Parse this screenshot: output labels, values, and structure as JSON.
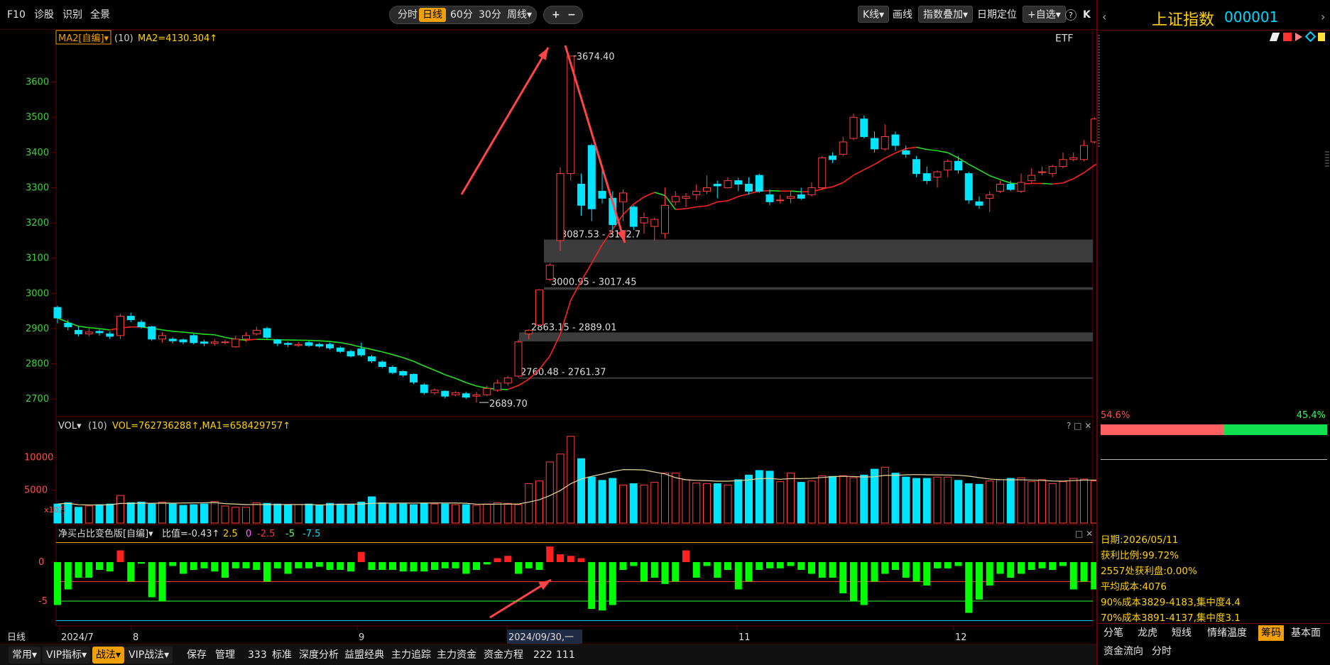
{
  "toolbar": {
    "f10": "F10",
    "diagnose": "诊股",
    "recognize": "识别",
    "panorama": "全景",
    "periods": [
      "分时",
      "日线",
      "60分",
      "30分",
      "周线▾"
    ],
    "active_period": "日线",
    "zoom_in": "+",
    "zoom_out": "−",
    "kline": "K线▾",
    "draw": "画线",
    "index_overlay": "指数叠加▾",
    "date_locate": "日期定位",
    "watchlist": "+自选▾",
    "help": "?",
    "collapse": "K"
  },
  "main_chart": {
    "indicator_label": "MA2[自编]▾",
    "indicator_params": "(10)",
    "indicator_value": "MA2=4130.304↑",
    "etf": "ETF",
    "y_ticks": [
      "3600",
      "3500",
      "3400",
      "3300",
      "3200",
      "3100",
      "3000",
      "2900",
      "2800",
      "2700"
    ],
    "annotations": {
      "peak": "3674.40",
      "low": "2689.70",
      "zone1": "3087.53 - 3152.7",
      "zone2": "3000.95 - 3017.45",
      "zone3": "2863.15 - 2889.01",
      "zone4": "2760.48 - 2761.37"
    }
  },
  "volume_panel": {
    "label": "VOL▾",
    "params": "(10)",
    "values": "VOL=762736288↑,MA1=658429757↑",
    "y_ticks": [
      "10000",
      "5000"
    ],
    "unit": "x10万"
  },
  "net_buy_panel": {
    "label": "净买占比变色版[自编]▾",
    "ratio": "比值=-0.43↑",
    "levels": [
      "2.5",
      "0",
      "-2.5",
      "-5",
      "-7.5"
    ],
    "level_colors": [
      "#ffd200",
      "#ff66ff",
      "#ff3333",
      "#66ff66",
      "#00e5ff"
    ],
    "y_ticks": [
      "0",
      "-5"
    ]
  },
  "x_axis": {
    "period_label": "日线",
    "labels": [
      "2024/7",
      "8",
      "9",
      "2024/09/30,一",
      "11",
      "12"
    ]
  },
  "bottom_bar": {
    "items": [
      "常用▾",
      "VIP指标▾",
      "战法▾",
      "VIP战法▾",
      "保存",
      "管理",
      "333",
      "标准",
      "深度分析",
      "益盟经典",
      "主力追踪",
      "主力资金",
      "资金方程",
      "222",
      "111"
    ],
    "selected": "战法▾"
  },
  "right_panel": {
    "title": "上证指数",
    "code": "000001",
    "left_pct": "54.6%",
    "right_pct": "45.4%",
    "info": [
      "日期:2026/05/11",
      "获利比例:99.72%",
      "2557处获利盘:0.00%",
      "平均成本:4076",
      "90%成本3829-4183,集中度4.4",
      "70%成本3891-4137,集中度3.1"
    ],
    "tabs_row1": [
      "分笔",
      "龙虎",
      "短线",
      "情绪温度",
      "筹码",
      "基本面"
    ],
    "tabs_row2": [
      "资金流向",
      "分时"
    ],
    "selected_tab": "筹码"
  },
  "colors": {
    "up": "#ff4040",
    "down": "#00e5ff",
    "ma_up": "#ff2020",
    "ma_down": "#20e020",
    "net_pos": "#ff2020",
    "net_neg": "#00ff00",
    "accent": "#f0a000",
    "gold": "#ffd200"
  },
  "chart_data": {
    "type": "candlestick",
    "title": "上证指数",
    "y_range": [
      2660,
      3700
    ],
    "candles": [
      [
        2960,
        2930,
        2965,
        2915
      ],
      [
        2915,
        2905,
        2925,
        2895
      ],
      [
        2895,
        2885,
        2905,
        2878
      ],
      [
        2885,
        2890,
        2900,
        2878
      ],
      [
        2892,
        2888,
        2898,
        2880
      ],
      [
        2885,
        2878,
        2892,
        2870
      ],
      [
        2880,
        2935,
        2942,
        2870
      ],
      [
        2935,
        2925,
        2945,
        2918
      ],
      [
        2918,
        2905,
        2925,
        2900
      ],
      [
        2905,
        2870,
        2908,
        2865
      ],
      [
        2870,
        2880,
        2890,
        2860
      ],
      [
        2870,
        2865,
        2875,
        2858
      ],
      [
        2868,
        2862,
        2872,
        2855
      ],
      [
        2880,
        2860,
        2885,
        2855
      ],
      [
        2862,
        2858,
        2868,
        2850
      ],
      [
        2858,
        2862,
        2870,
        2852
      ],
      [
        2860,
        2862,
        2868,
        2855
      ],
      [
        2848,
        2870,
        2880,
        2845
      ],
      [
        2870,
        2880,
        2890,
        2862
      ],
      [
        2885,
        2895,
        2905,
        2880
      ],
      [
        2900,
        2875,
        2905,
        2870
      ],
      [
        2868,
        2858,
        2870,
        2850
      ],
      [
        2858,
        2855,
        2862,
        2848
      ],
      [
        2852,
        2855,
        2862,
        2848
      ],
      [
        2860,
        2852,
        2865,
        2848
      ],
      [
        2855,
        2850,
        2860,
        2845
      ],
      [
        2855,
        2845,
        2860,
        2840
      ],
      [
        2845,
        2835,
        2850,
        2830
      ],
      [
        2835,
        2822,
        2840,
        2818
      ],
      [
        2842,
        2825,
        2860,
        2820
      ],
      [
        2820,
        2808,
        2825,
        2802
      ],
      [
        2805,
        2792,
        2810,
        2788
      ],
      [
        2790,
        2775,
        2795,
        2770
      ],
      [
        2778,
        2768,
        2782,
        2762
      ],
      [
        2770,
        2748,
        2772,
        2742
      ],
      [
        2740,
        2718,
        2745,
        2712
      ],
      [
        2718,
        2725,
        2730,
        2712
      ],
      [
        2722,
        2708,
        2725,
        2702
      ],
      [
        2712,
        2718,
        2722,
        2708
      ],
      [
        2715,
        2705,
        2720,
        2700
      ],
      [
        2708,
        2712,
        2720,
        2690
      ],
      [
        2712,
        2730,
        2738,
        2708
      ],
      [
        2725,
        2745,
        2755,
        2720
      ],
      [
        2745,
        2760,
        2765,
        2738
      ],
      [
        2765,
        2862,
        2868,
        2760
      ],
      [
        2885,
        2895,
        2898,
        2870
      ],
      [
        2910,
        3010,
        3012,
        2905
      ],
      [
        3040,
        3080,
        3085,
        3035
      ],
      [
        3150,
        3340,
        3358,
        3120
      ],
      [
        3340,
        3674,
        3674,
        3320
      ],
      [
        3310,
        3250,
        3340,
        3220
      ],
      [
        3420,
        3240,
        3425,
        3205
      ],
      [
        3290,
        3270,
        3350,
        3255
      ],
      [
        3270,
        3195,
        3290,
        3180
      ],
      [
        3260,
        3285,
        3295,
        3205
      ],
      [
        3245,
        3190,
        3250,
        3180
      ],
      [
        3200,
        3215,
        3230,
        3170
      ],
      [
        3190,
        3210,
        3215,
        3150
      ],
      [
        3170,
        3250,
        3300,
        3155
      ],
      [
        3260,
        3275,
        3290,
        3250
      ],
      [
        3270,
        3275,
        3285,
        3245
      ],
      [
        3280,
        3290,
        3310,
        3265
      ],
      [
        3290,
        3300,
        3335,
        3282
      ],
      [
        3310,
        3305,
        3320,
        3270
      ],
      [
        3300,
        3320,
        3330,
        3298
      ],
      [
        3320,
        3310,
        3328,
        3290
      ],
      [
        3310,
        3290,
        3330,
        3280
      ],
      [
        3335,
        3290,
        3340,
        3285
      ],
      [
        3280,
        3260,
        3295,
        3250
      ],
      [
        3265,
        3265,
        3280,
        3255
      ],
      [
        3270,
        3275,
        3290,
        3255
      ],
      [
        3280,
        3270,
        3300,
        3265
      ],
      [
        3280,
        3300,
        3315,
        3275
      ],
      [
        3300,
        3385,
        3390,
        3295
      ],
      [
        3390,
        3380,
        3400,
        3370
      ],
      [
        3395,
        3430,
        3445,
        3390
      ],
      [
        3440,
        3500,
        3510,
        3435
      ],
      [
        3495,
        3445,
        3505,
        3440
      ],
      [
        3440,
        3410,
        3460,
        3400
      ],
      [
        3410,
        3445,
        3480,
        3405
      ],
      [
        3450,
        3420,
        3460,
        3405
      ],
      [
        3405,
        3395,
        3420,
        3385
      ],
      [
        3380,
        3340,
        3390,
        3330
      ],
      [
        3340,
        3320,
        3360,
        3310
      ],
      [
        3330,
        3345,
        3350,
        3300
      ],
      [
        3350,
        3375,
        3380,
        3330
      ],
      [
        3375,
        3350,
        3390,
        3340
      ],
      [
        3340,
        3265,
        3345,
        3255
      ],
      [
        3260,
        3250,
        3275,
        3240
      ],
      [
        3270,
        3280,
        3290,
        3230
      ],
      [
        3290,
        3310,
        3320,
        3285
      ],
      [
        3310,
        3295,
        3320,
        3290
      ],
      [
        3290,
        3315,
        3340,
        3285
      ],
      [
        3320,
        3335,
        3355,
        3310
      ],
      [
        3345,
        3345,
        3360,
        3335
      ],
      [
        3340,
        3360,
        3365,
        3330
      ],
      [
        3360,
        3380,
        3400,
        3355
      ],
      [
        3380,
        3385,
        3400,
        3375
      ],
      [
        3380,
        3420,
        3435,
        3375
      ],
      [
        3430,
        3495,
        3500,
        3425
      ],
      [
        3440,
        3425,
        3450,
        3420
      ],
      [
        3430,
        3460,
        3470,
        3420
      ],
      [
        3450,
        3395,
        3455,
        3390
      ],
      [
        3395,
        3385,
        3405,
        3380
      ],
      [
        3390,
        3370,
        3400,
        3365
      ],
      [
        3370,
        3380,
        3400,
        3360
      ],
      [
        3375,
        3360,
        3385,
        3355
      ]
    ],
    "volume": [
      2.9,
      3.1,
      2.4,
      2.6,
      2.8,
      2.9,
      4.2,
      3.1,
      3.2,
      2.9,
      3.2,
      2.9,
      2.7,
      2.8,
      2.9,
      3.3,
      2.6,
      2.4,
      2.4,
      3.1,
      3.0,
      2.9,
      2.8,
      2.8,
      2.9,
      2.7,
      3.0,
      2.9,
      2.8,
      3.2,
      4.0,
      3.1,
      2.9,
      2.9,
      2.8,
      3.0,
      2.9,
      2.9,
      2.8,
      2.8,
      2.7,
      2.9,
      3.1,
      3.0,
      2.8,
      6.0,
      6.4,
      9.3,
      10.5,
      13.2,
      9.8,
      7.0,
      6.5,
      6.8,
      5.8,
      6.0,
      5.8,
      6.2,
      7.6,
      7.6,
      6.6,
      6.1,
      6.0,
      6.0,
      5.8,
      6.6,
      7.3,
      8.0,
      7.9,
      6.3,
      7.6,
      6.2,
      6.4,
      7.2,
      7.1,
      7.2,
      6.9,
      7.3,
      8.2,
      8.5,
      7.6,
      7.0,
      6.8,
      6.8,
      7.0,
      7.0,
      6.5,
      6.0,
      5.9,
      6.4,
      6.6,
      6.8,
      6.9,
      6.3,
      6.6,
      6.0,
      6.3,
      6.8,
      6.7,
      6.4,
      6.4,
      6.3,
      6.0,
      5.8,
      5.9,
      5.8
    ],
    "net_buy": [
      -5.5,
      -3.5,
      -2.0,
      -2.0,
      -1.0,
      -1.2,
      1.5,
      -2.5,
      -0.2,
      -4.5,
      -5.0,
      -0.5,
      -1.5,
      -1.0,
      -0.8,
      -1.2,
      -2.0,
      -0.8,
      -0.8,
      -1.0,
      -2.5,
      -0.8,
      -1.5,
      -0.8,
      -0.8,
      -0.6,
      -1.0,
      -1.0,
      -1.2,
      1.3,
      -1.0,
      -1.0,
      -1.0,
      -1.2,
      -1.2,
      -1.2,
      -1.0,
      -0.8,
      -0.8,
      -1.5,
      -1.0,
      -0.3,
      0.5,
      0.8,
      -1.5,
      -0.8,
      -1.0,
      2.0,
      1.0,
      0.8,
      0.5,
      -6.0,
      -6.2,
      -5.5,
      -1.0,
      -0.5,
      -2.5,
      -2.0,
      -2.8,
      -2.5,
      1.5,
      -2.0,
      -0.5,
      -2.0,
      -1.0,
      -3.5,
      -2.5,
      -1.0,
      -0.8,
      -0.8,
      -0.5,
      -1.0,
      -1.5,
      -2.0,
      -2.0,
      -4.0,
      -5.0,
      -5.5,
      -2.5,
      -1.5,
      -1.0,
      -2.0,
      -2.5,
      -3.0,
      -0.8,
      -0.8,
      -0.5,
      -6.5,
      -4.8,
      -3.0,
      -1.5,
      -2.0,
      -1.5,
      -1.0,
      -0.8,
      -1.0,
      -0.5,
      -3.5,
      -2.5,
      -3.5,
      -0.6,
      -1.0,
      -1.0,
      -4.0,
      -5.5,
      -2.5
    ]
  }
}
